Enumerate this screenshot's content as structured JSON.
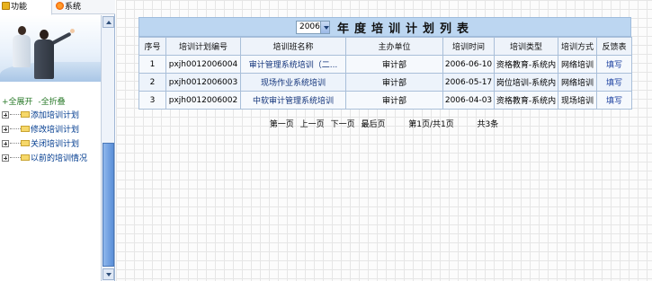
{
  "tabs": [
    {
      "label": "功能"
    },
    {
      "label": "系统"
    }
  ],
  "tree": {
    "expand_all": "+全展开",
    "collapse_all": "-全折叠",
    "items": [
      {
        "label": "添加培训计划"
      },
      {
        "label": "修改培训计划"
      },
      {
        "label": "关闭培训计划"
      },
      {
        "label": "以前的培训情况"
      }
    ]
  },
  "year_select": {
    "value": "2006"
  },
  "table_title": "年度培训计划列表",
  "columns": [
    "序号",
    "培训计划编号",
    "培训班名称",
    "主办单位",
    "培训时间",
    "培训类型",
    "培训方式",
    "反馈表"
  ],
  "rows": [
    {
      "no": "1",
      "code": "pxjh0012006004",
      "name": "审计管理系统培训（二...",
      "org": "审计部",
      "date": "2006-06-10",
      "type": "资格教育-系统内",
      "mode": "网络培训",
      "feedback": "填写"
    },
    {
      "no": "2",
      "code": "pxjh0012006003",
      "name": "现场作业系统培训",
      "org": "审计部",
      "date": "2006-05-17",
      "type": "岗位培训-系统内",
      "mode": "网络培训",
      "feedback": "填写"
    },
    {
      "no": "3",
      "code": "pxjh0012006002",
      "name": "中软审计管理系统培训",
      "org": "审计部",
      "date": "2006-04-03",
      "type": "资格教育-系统内",
      "mode": "现场培训",
      "feedback": "填写"
    }
  ],
  "pager": {
    "first": "第一页",
    "prev": "上一页",
    "next": "下一页",
    "last": "最后页",
    "page_info": "第1页/共1页",
    "total": "共3条"
  }
}
